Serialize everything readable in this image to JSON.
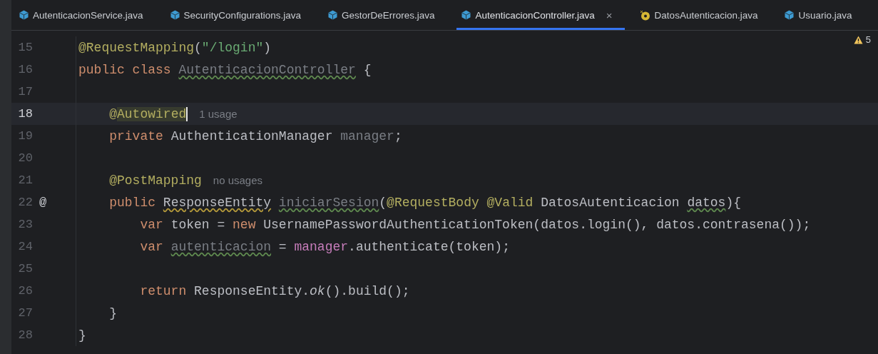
{
  "tabs": [
    {
      "label": "AutenticacionService.java",
      "kind": "class",
      "selected": false
    },
    {
      "label": "SecurityConfigurations.java",
      "kind": "class",
      "selected": false
    },
    {
      "label": "GestorDeErrores.java",
      "kind": "class",
      "selected": false
    },
    {
      "label": "AutenticacionController.java",
      "kind": "class",
      "selected": true,
      "close": "×"
    },
    {
      "label": "DatosAutenticacion.java",
      "kind": "record",
      "selected": false
    },
    {
      "label": "Usuario.java",
      "kind": "class",
      "selected": false
    }
  ],
  "warnings": {
    "count": "5"
  },
  "lines": [
    {
      "number": "15",
      "current": false,
      "kind": "top",
      "tokens": [
        {
          "kind": "ann",
          "text": "@RequestMapping",
          "typo": false
        },
        {
          "kind": "plain",
          "text": "(",
          "typo": false
        },
        {
          "kind": "str",
          "text": "\"/login\"",
          "typo": false
        },
        {
          "kind": "plain",
          "text": ")",
          "typo": false
        }
      ]
    },
    {
      "number": "16",
      "current": false,
      "kind": "top",
      "tokens": [
        {
          "kind": "kw",
          "text": "public class ",
          "typo": false
        },
        {
          "kind": "unused",
          "text": "AutenticacionController",
          "typo": true
        },
        {
          "kind": "plain",
          "text": " {",
          "typo": false
        }
      ]
    },
    {
      "number": "17",
      "current": false,
      "kind": "blank"
    },
    {
      "number": "18",
      "current": true,
      "kind": "member",
      "tokens": [
        {
          "kind": "ann",
          "text": "@",
          "typo": false
        },
        {
          "kind": "caret",
          "text": "Autowired",
          "typo": false
        }
      ],
      "hint": "1 usage"
    },
    {
      "number": "19",
      "current": false,
      "kind": "member",
      "tokens": [
        {
          "kind": "kw",
          "text": "private ",
          "typo": false
        },
        {
          "kind": "plain",
          "text": "AuthenticationManager ",
          "typo": false
        },
        {
          "kind": "unused",
          "text": "manager",
          "typo": false
        },
        {
          "kind": "plain",
          "text": ";",
          "typo": false
        }
      ]
    },
    {
      "number": "20",
      "current": false,
      "kind": "blank"
    },
    {
      "number": "21",
      "current": false,
      "kind": "member",
      "tokens": [
        {
          "kind": "ann",
          "text": "@PostMapping",
          "typo": false
        }
      ],
      "hint": "no usages"
    },
    {
      "number": "22",
      "current": false,
      "gutter_mark": "@",
      "kind": "member",
      "tokens": [
        {
          "kind": "kw",
          "text": "public ",
          "typo": false
        },
        {
          "kind": "warning",
          "text": "ResponseEntity",
          "typo": false
        },
        {
          "kind": "unused",
          "text": "iniciarSesion",
          "typo": true
        },
        {
          "kind": "plain",
          "text": "(",
          "typo": false
        },
        {
          "kind": "ann",
          "text": "@RequestBody @Valid ",
          "typo": false
        },
        {
          "kind": "plain",
          "text": "DatosAutenticacion ",
          "typo": false
        },
        {
          "kind": "plain",
          "text": "datos",
          "typo": true
        },
        {
          "kind": "plain",
          "text": "){",
          "typo": false
        }
      ]
    },
    {
      "number": "23",
      "current": false,
      "kind": "statement",
      "tokens": [
        {
          "kind": "kw",
          "text": "var ",
          "typo": false
        },
        {
          "kind": "plain",
          "text": "token = ",
          "typo": false
        },
        {
          "kind": "kw",
          "text": "new ",
          "typo": false
        },
        {
          "kind": "plain",
          "text": "UsernamePasswordAuthenticationToken(datos.login(), datos.contrasena());",
          "typo": false
        }
      ]
    },
    {
      "number": "24",
      "current": false,
      "kind": "statement",
      "tokens": [
        {
          "kind": "kw",
          "text": "var ",
          "typo": false
        },
        {
          "kind": "unused",
          "text": "autenticacion",
          "typo": true
        },
        {
          "kind": "plain",
          "text": " = ",
          "typo": false
        },
        {
          "kind": "field",
          "text": "manager",
          "typo": false
        },
        {
          "kind": "plain",
          "text": ".authenticate(token);",
          "typo": false
        }
      ]
    },
    {
      "number": "25",
      "current": false,
      "kind": "blank"
    },
    {
      "number": "26",
      "current": false,
      "kind": "statement",
      "tokens": [
        {
          "kind": "kw",
          "text": "return ",
          "typo": false
        },
        {
          "kind": "plain",
          "text": "ResponseEntity.",
          "typo": false
        },
        {
          "kind": "static",
          "text": "ok",
          "typo": false
        },
        {
          "kind": "plain",
          "text": "().build();",
          "typo": false
        }
      ]
    },
    {
      "number": "27",
      "current": false,
      "kind": "member",
      "tokens": [
        {
          "kind": "plain",
          "text": "}",
          "typo": false
        }
      ]
    },
    {
      "number": "28",
      "current": false,
      "kind": "top",
      "tokens": [
        {
          "kind": "plain",
          "text": "}",
          "typo": false
        }
      ]
    }
  ]
}
